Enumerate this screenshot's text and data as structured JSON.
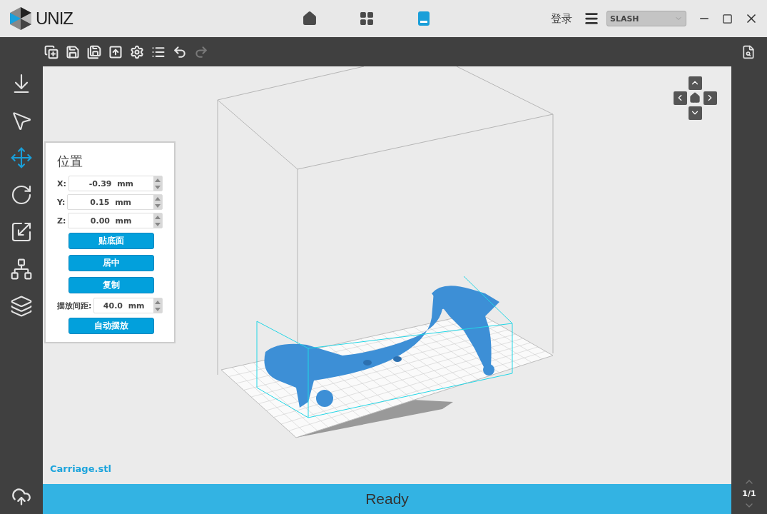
{
  "header": {
    "brand": "UNIZ",
    "nav_tabs": [
      {
        "kind": "home",
        "selected": false
      },
      {
        "kind": "grid",
        "selected": false
      },
      {
        "kind": "printer",
        "selected": true
      }
    ],
    "login": "登录",
    "printer_select": {
      "value": "SLASH"
    }
  },
  "toolbar": [
    {
      "kind": "add",
      "disabled": false
    },
    {
      "kind": "save",
      "disabled": false
    },
    {
      "kind": "save-as",
      "disabled": false
    },
    {
      "kind": "export",
      "disabled": false
    },
    {
      "kind": "settings",
      "disabled": false
    },
    {
      "kind": "list",
      "disabled": false
    },
    {
      "kind": "undo",
      "disabled": false
    },
    {
      "kind": "redo",
      "disabled": true
    }
  ],
  "tools": [
    {
      "kind": "import",
      "selected": false
    },
    {
      "kind": "select",
      "selected": false
    },
    {
      "kind": "move",
      "selected": true
    },
    {
      "kind": "rotate",
      "selected": false
    },
    {
      "kind": "scale",
      "selected": false
    },
    {
      "kind": "support",
      "selected": false
    },
    {
      "kind": "layers",
      "selected": false
    }
  ],
  "position_panel": {
    "title": "位置",
    "fields": [
      {
        "label": "X:",
        "value": "-0.39  mm"
      },
      {
        "label": "Y:",
        "value": "0.15  mm"
      },
      {
        "label": "Z:",
        "value": "0.00  mm"
      }
    ],
    "buttons": [
      "贴底面",
      "居中",
      "复制"
    ],
    "spacing": {
      "label": "摆放间距:",
      "value": "40.0  mm"
    },
    "auto_button": "自动摆放"
  },
  "file_name": "Carriage.stl",
  "status": "Ready",
  "page_counter": "1/1"
}
